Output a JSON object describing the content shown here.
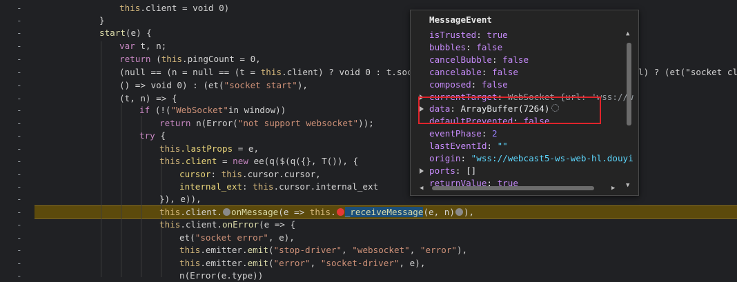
{
  "editor": {
    "gutter_marker": "-",
    "line_0": {
      "this": "this",
      "rest": ".client = void 0)"
    },
    "line_1": "}",
    "line_2": {
      "fn": "start",
      "rest": "(e) {"
    },
    "line_3": {
      "kw": "var",
      "rest": " t, n;"
    },
    "line_4": {
      "kw": "return",
      "a": " (",
      "this": "this",
      "b": ".pingCount = 0,"
    },
    "line_5": {
      "a": "(null == (n = null == (t = ",
      "this": "this",
      "b": ".client) ? void 0 : t.socke",
      "right": "l) ? (et(\"socket cli"
    },
    "line_6": {
      "a": "() => void 0) : (et(",
      "str": "\"socket start\"",
      "b": "),"
    },
    "line_7": "(t, n) => {",
    "line_8": {
      "kw": "if",
      "a": " (!(",
      "str": "\"WebSocket\"",
      "b": "in window))"
    },
    "line_9": {
      "kw": "return",
      "a": " n(Error(",
      "str": "\"not support websocket\"",
      "b": "));"
    },
    "line_10": {
      "kw": "try",
      "b": " {"
    },
    "line_11": {
      "this": "this",
      "prop": ".lastProps",
      "b": " = e,"
    },
    "line_12": {
      "this": "this",
      "prop": ".client",
      "a": " = ",
      "kw": "new",
      "b": " ee(q($(q({}, T()), {"
    },
    "line_13": {
      "prop": "cursor",
      "a": ": ",
      "this": "this",
      "b": ".cursor.cursor,"
    },
    "line_14": {
      "prop": "internal_ext",
      "a": ": ",
      "this": "this",
      "b": ".cursor.internal_ext"
    },
    "line_15": "}), e)),",
    "line_16": {
      "this": "this",
      "a": ".client.",
      "fn": "onMessage",
      "b": "(e => ",
      "this2": "this",
      "c": ".",
      "sel": "_receiveMessage",
      "d": "(e, n)",
      "e": "),"
    },
    "line_17": {
      "this": "this",
      "a": ".client.",
      "fn": "onError",
      "b": "(e => {"
    },
    "line_18": {
      "a": "et(",
      "str": "\"socket error\"",
      "b": ", e),"
    },
    "line_19": {
      "this": "this",
      "a": ".emitter.",
      "fn": "emit",
      "b": "(",
      "s1": "\"stop-driver\"",
      "c": ", ",
      "s2": "\"websocket\"",
      "d": ", ",
      "s3": "\"error\"",
      "e": "),"
    },
    "line_20": {
      "this": "this",
      "a": ".emitter.",
      "fn": "emit",
      "b": "(",
      "s1": "\"error\"",
      "c": ", ",
      "s2": "\"socket-driver\"",
      "d": ", e),"
    },
    "line_21": "n(Error(e.type))"
  },
  "popover": {
    "title": "MessageEvent",
    "rows": [
      {
        "key": "isTrusted",
        "value": "true",
        "kind": "bool"
      },
      {
        "key": "bubbles",
        "value": "false",
        "kind": "bool"
      },
      {
        "key": "cancelBubble",
        "value": "false",
        "kind": "bool"
      },
      {
        "key": "cancelable",
        "value": "false",
        "kind": "bool"
      },
      {
        "key": "composed",
        "value": "false",
        "kind": "bool"
      },
      {
        "key": "currentTarget",
        "value": "WebSocket {url: 'wss://w",
        "kind": "obj"
      },
      {
        "key": "data",
        "value": "ArrayBuffer(7264)",
        "kind": "plain"
      },
      {
        "key": "defaultPrevented",
        "value": "false",
        "kind": "bool"
      },
      {
        "key": "eventPhase",
        "value": "2",
        "kind": "num"
      },
      {
        "key": "lastEventId",
        "value": "\"\"",
        "kind": "str"
      },
      {
        "key": "origin",
        "value": "\"wss://webcast5-ws-web-hl.douyi",
        "kind": "str"
      },
      {
        "key": "ports",
        "value": "[]",
        "kind": "plain"
      },
      {
        "key": "returnValue",
        "value": "true",
        "kind": "bool"
      }
    ]
  },
  "colors": {
    "background": "#202124",
    "paused_line": "#5c4a0c",
    "highlight_box": "#e0242b",
    "breakpoint_active": "#e53935"
  }
}
